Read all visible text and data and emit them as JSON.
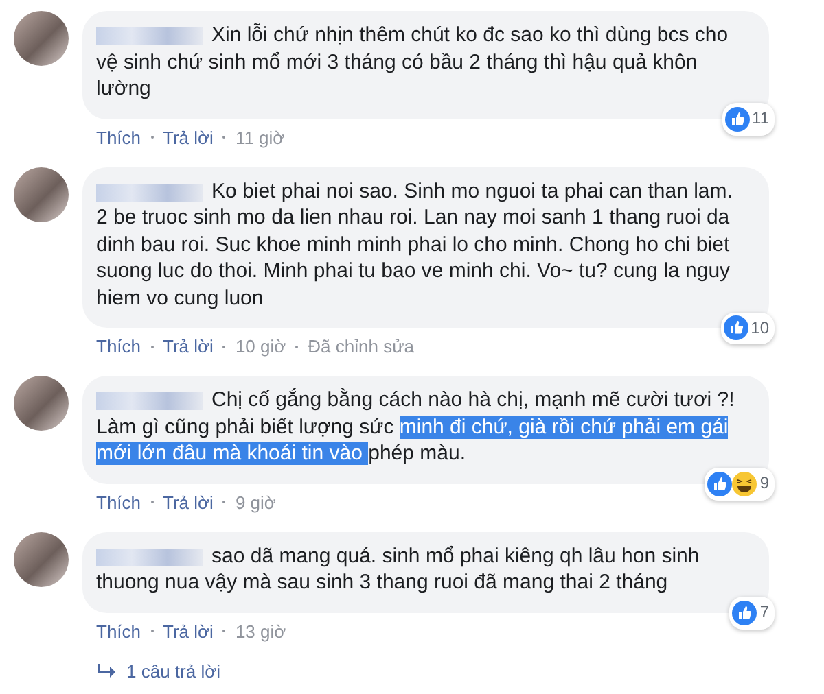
{
  "comments": [
    {
      "text": [
        {
          "t": "Xin lỗi chứ nhịn thêm chút ko đc sao ko thì dùng bcs cho vệ sinh chứ sinh mổ mới 3 tháng có bầu 2 tháng thì hậu quả khôn lường",
          "selected": false
        }
      ],
      "reactions": [
        {
          "kind": "like"
        }
      ],
      "reaction_count": "11",
      "actions": [
        "Thích",
        "Trả lời"
      ],
      "time": "11 giờ"
    },
    {
      "text": [
        {
          "t": "Ko biet phai noi sao. Sinh mo nguoi ta phai can than lam. 2 be truoc sinh mo da lien nhau roi. Lan nay moi sanh 1 thang ruoi da dinh bau roi. Suc khoe minh minh phai lo cho minh. Chong ho chi biet suong luc do thoi. Minh phai tu bao ve minh chi. Vo~ tu? cung la nguy hiem vo cung luon",
          "selected": false
        }
      ],
      "reactions": [
        {
          "kind": "like"
        }
      ],
      "reaction_count": "10",
      "actions": [
        "Thích",
        "Trả lời"
      ],
      "time": "10 giờ",
      "edited": "Đã chỉnh sửa"
    },
    {
      "text": [
        {
          "t": "Chị cố gắng bằng cách nào hà chị, mạnh mẽ cười tươi ?! Làm gì cũng phải biết lượng sức ",
          "selected": false
        },
        {
          "t": "minh đi chứ, già rồi chứ phải em gái mới lớn đâu mà khoái tin vào ",
          "selected": true
        },
        {
          "t": "phép màu.",
          "selected": false
        }
      ],
      "reactions": [
        {
          "kind": "like"
        },
        {
          "kind": "haha"
        }
      ],
      "reaction_count": "9",
      "actions": [
        "Thích",
        "Trả lời"
      ],
      "time": "9 giờ"
    },
    {
      "text": [
        {
          "t": "sao dã mang quá. sinh mổ phai kiêng qh lâu hon sinh thuong nua vậy mà sau sinh 3 thang ruoi đã mang thai 2 tháng",
          "selected": false
        }
      ],
      "reactions": [
        {
          "kind": "like"
        }
      ],
      "reaction_count": "7",
      "actions": [
        "Thích",
        "Trả lời"
      ],
      "time": "13 giờ",
      "replies_link": "1 câu trả lời"
    }
  ]
}
